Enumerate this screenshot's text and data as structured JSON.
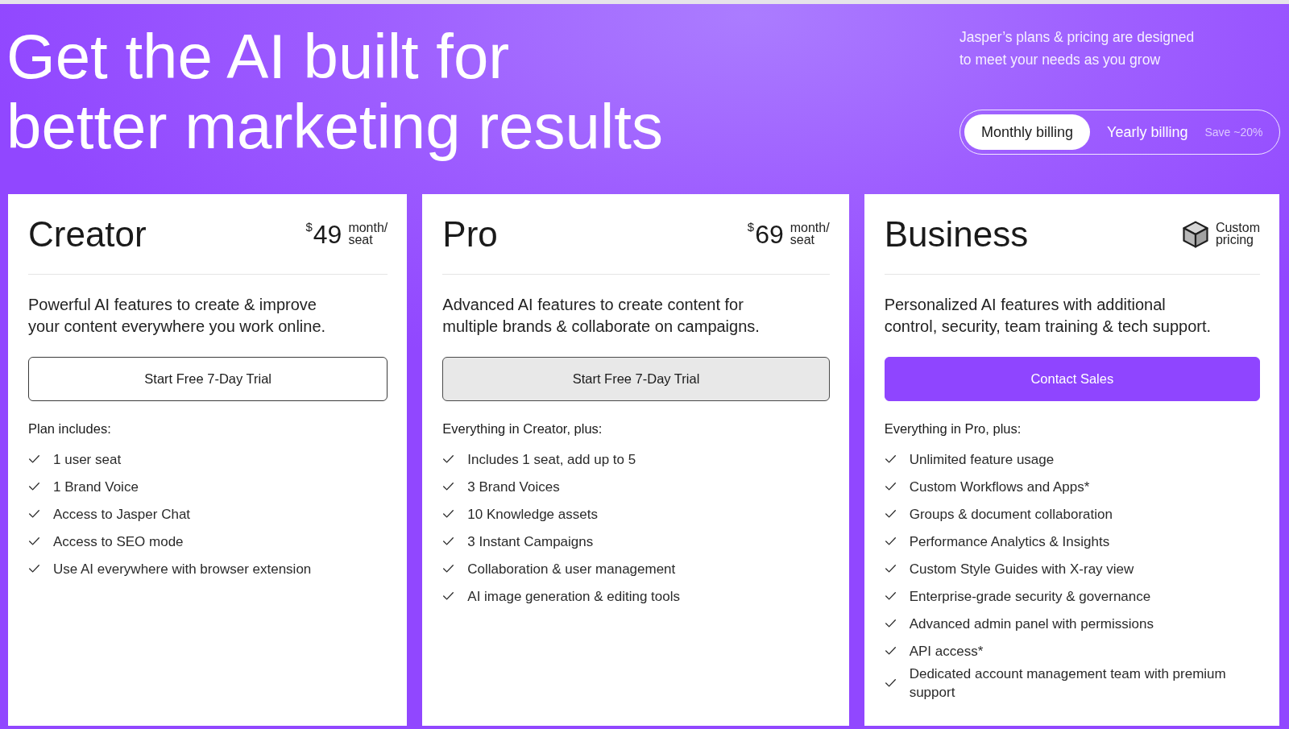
{
  "hero": {
    "headline": "Get the AI built for\nbetter marketing results",
    "tagline": "Jasper’s plans & pricing are designed\nto meet your needs as you grow",
    "billing": {
      "options": [
        {
          "label": "Monthly billing",
          "selected": true
        },
        {
          "label": "Yearly billing",
          "selected": false,
          "note": "Save ~20%"
        }
      ]
    }
  },
  "plans": [
    {
      "name": "Creator",
      "price": {
        "kind": "amount",
        "currency": "$",
        "amount": "49",
        "unit": "month/\nseat"
      },
      "description": "Powerful AI features to create & improve\nyour content everywhere you work online.",
      "button": {
        "label": "Start Free 7-Day Trial",
        "kind": "outline"
      },
      "features_heading": "Plan includes:",
      "features": [
        "1 user seat",
        "1 Brand Voice",
        "Access to Jasper Chat",
        "Access to SEO mode",
        "Use AI everywhere with browser extension"
      ]
    },
    {
      "name": "Pro",
      "price": {
        "kind": "amount",
        "currency": "$",
        "amount": "69",
        "unit": "month/\nseat"
      },
      "description": "Advanced AI features to create content for\nmultiple brands & collaborate on campaigns.",
      "button": {
        "label": "Start Free 7-Day Trial",
        "kind": "grey"
      },
      "features_heading": "Everything in Creator, plus:",
      "features": [
        "Includes 1 seat, add up to 5",
        "3 Brand Voices",
        "10 Knowledge assets",
        "3 Instant Campaigns",
        "Collaboration & user management",
        "AI image generation & editing tools"
      ]
    },
    {
      "name": "Business",
      "price": {
        "kind": "custom",
        "label": "Custom\npricing"
      },
      "description": "Personalized AI features with additional\ncontrol, security, team training & tech support.",
      "button": {
        "label": "Contact Sales",
        "kind": "primary"
      },
      "features_heading": "Everything in Pro, plus:",
      "features": [
        "Unlimited feature usage",
        "Custom Workflows and Apps*",
        "Groups & document collaboration",
        "Performance Analytics & Insights",
        "Custom Style Guides with X-ray view",
        "Enterprise-grade security & governance",
        "Advanced admin panel with permissions",
        "API access*",
        "Dedicated account management team with premium support"
      ]
    }
  ]
}
